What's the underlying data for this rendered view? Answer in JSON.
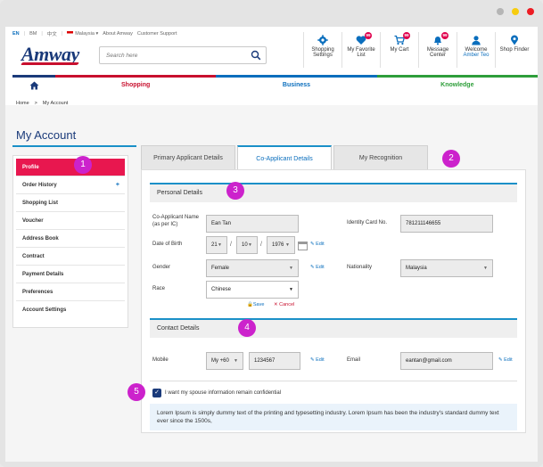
{
  "window": {
    "dot_colors": [
      "#b5b5b5",
      "#f7cc0f",
      "#ed1c24"
    ]
  },
  "utility": {
    "lang_en": "EN",
    "lang_bm": "BM",
    "lang_zh": "中文",
    "country": "Malaysia",
    "about": "About Amway",
    "support": "Customer Support"
  },
  "brand": {
    "logo_text": "Amway"
  },
  "search": {
    "placeholder": "Search here"
  },
  "nav_icons": [
    {
      "label": "Shopping Settings",
      "badge": ""
    },
    {
      "label": "My Favorite List",
      "badge": "99"
    },
    {
      "label": "My Cart",
      "badge": "99"
    },
    {
      "label": "Message Center",
      "badge": "99"
    },
    {
      "label": "Welcome",
      "sub": "Amber Teo",
      "badge": ""
    },
    {
      "label": "Shop Finder",
      "badge": ""
    }
  ],
  "main_nav": {
    "shopping": "Shopping",
    "business": "Business",
    "knowledge": "Knowledge"
  },
  "breadcrumb": {
    "home": "Home",
    "sep": ">",
    "current": "My Account"
  },
  "page_title": "My Account",
  "sidebar": {
    "items": [
      {
        "label": "Profile"
      },
      {
        "label": "Order History",
        "plus": "+"
      },
      {
        "label": "Shopping List"
      },
      {
        "label": "Voucher"
      },
      {
        "label": "Address Book"
      },
      {
        "label": "Contract"
      },
      {
        "label": "Payment Details"
      },
      {
        "label": "Preferences"
      },
      {
        "label": "Account Settings"
      }
    ]
  },
  "tabs": [
    "Primary Applicant Details",
    "Co-Applicant Details",
    "My Recognition"
  ],
  "personal": {
    "heading": "Personal Details",
    "name_label": "Co-Applicant Name (as per IC)",
    "name_value": "Ean Tan",
    "dob_label": "Date of Birth",
    "dob_day": "21",
    "dob_month": "10",
    "dob_year": "1976",
    "gender_label": "Gender",
    "gender_value": "Female",
    "race_label": "Race",
    "race_value": "Chinese",
    "ic_label": "Identity Card No.",
    "ic_value": "781211146655",
    "nationality_label": "Nationality",
    "nationality_value": "Malaysia",
    "edit": "Edit",
    "save": "Save",
    "cancel": "Cancel"
  },
  "contact": {
    "heading": "Contact Details",
    "mobile_label": "Mobile",
    "mobile_code": "My +60",
    "mobile_value": "1234567",
    "email_label": "Email",
    "email_value": "eantan@gmail.com",
    "edit": "Edit"
  },
  "confidential": {
    "label": "I want my spouse information remain confidential",
    "checked": true
  },
  "lorem": "Lorem Ipsum is simply dummy text of the printing and typesetting industry. Lorem Ipsum has been the industry's standard dummy text ever since the 1500s,",
  "markers": [
    "1",
    "2",
    "3",
    "4",
    "5"
  ],
  "colors": {
    "brand_blue": "#1a3a7a",
    "accent_pink": "#e8174f",
    "link_blue": "#0a6ebd",
    "marker": "#cc22cc"
  }
}
